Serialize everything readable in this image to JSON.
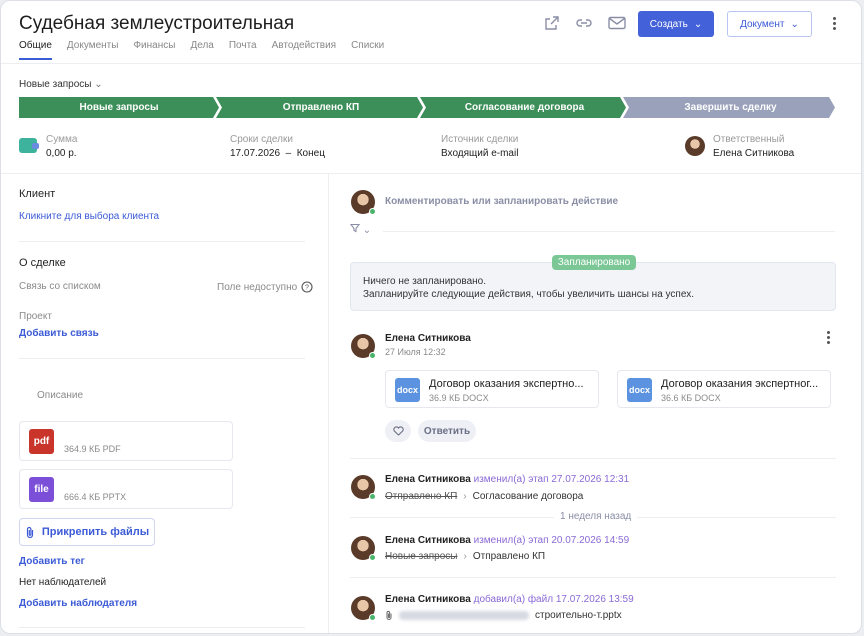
{
  "header": {
    "title": "Судебная землеустроительная",
    "create_label": "Создать",
    "document_label": "Документ",
    "tabs": [
      "Общие",
      "Документы",
      "Финансы",
      "Дела",
      "Почта",
      "Автодействия",
      "Списки"
    ]
  },
  "pipeline": {
    "selector_label": "Новые запросы",
    "stages": [
      {
        "label": "Новые запросы",
        "color": "#3d8f5a"
      },
      {
        "label": "Отправлено КП",
        "color": "#3d8f5a"
      },
      {
        "label": "Согласование договора",
        "color": "#3d8f5a"
      },
      {
        "label": "Завершить сделку",
        "color": "#9aa1bb"
      }
    ]
  },
  "info": {
    "sum_label": "Сумма",
    "sum_value": "0,00 р.",
    "deadline_label": "Сроки сделки",
    "deadline_value": "17.07.2026  –  Конец",
    "source_label": "Источник сделки",
    "source_value": "Входящий e-mail",
    "responsible_label": "Ответственный",
    "responsible_value": "Елена Ситникова"
  },
  "left": {
    "client_title": "Клиент",
    "client_link": "Кликните для выбора клиента",
    "deal_title": "О сделке",
    "link_list_label": "Связь со списком",
    "field_unavailable": "Поле недоступно",
    "project_label": "Проект",
    "add_link": "Добавить связь",
    "description_label": "Описание",
    "files": [
      {
        "type": "pdf",
        "meta": "364.9 КБ PDF",
        "color": "#c9352b"
      },
      {
        "type": "file",
        "meta": "666.4 КБ PPTX",
        "color": "#7b4fd8"
      }
    ],
    "attach_label": "Прикрепить файлы",
    "add_tag": "Добавить тег",
    "no_watchers": "Нет наблюдателей",
    "add_watcher": "Добавить наблюдателя"
  },
  "feed": {
    "comment_placeholder": "Комментировать или запланировать действие",
    "planned_badge": "Запланировано",
    "planned_line1": "Ничего не запланировано.",
    "planned_line2": "Запланируйте следующие действия, чтобы увеличить шансы на успех.",
    "post_author": "Елена Ситникова",
    "post_date": "27 Июля 12:32",
    "docs": [
      {
        "icon": "docx",
        "name": "Договор оказания экспертно...",
        "meta": "36.9 КБ DOCX"
      },
      {
        "icon": "docx",
        "name": "Договор оказания экспертног...",
        "meta": "36.6 КБ DOCX"
      }
    ],
    "reply_label": "Ответить",
    "events": [
      {
        "author": "Елена Ситникова",
        "action": "изменил(а) этап",
        "date": "27.07.2026 12:31",
        "from": "Отправлено КП",
        "to": "Согласование договора"
      },
      {
        "author": "Елена Ситникова",
        "action": "изменил(а) этап",
        "date": "20.07.2026 14:59",
        "from": "Новые запросы",
        "to": "Отправлено КП"
      },
      {
        "author": "Елена Ситникова",
        "action": "добавил(а) файл",
        "date": "17.07.2026 13:59",
        "file_suffix": "строительно-т.pptx"
      }
    ],
    "week_label": "1 неделя назад"
  }
}
